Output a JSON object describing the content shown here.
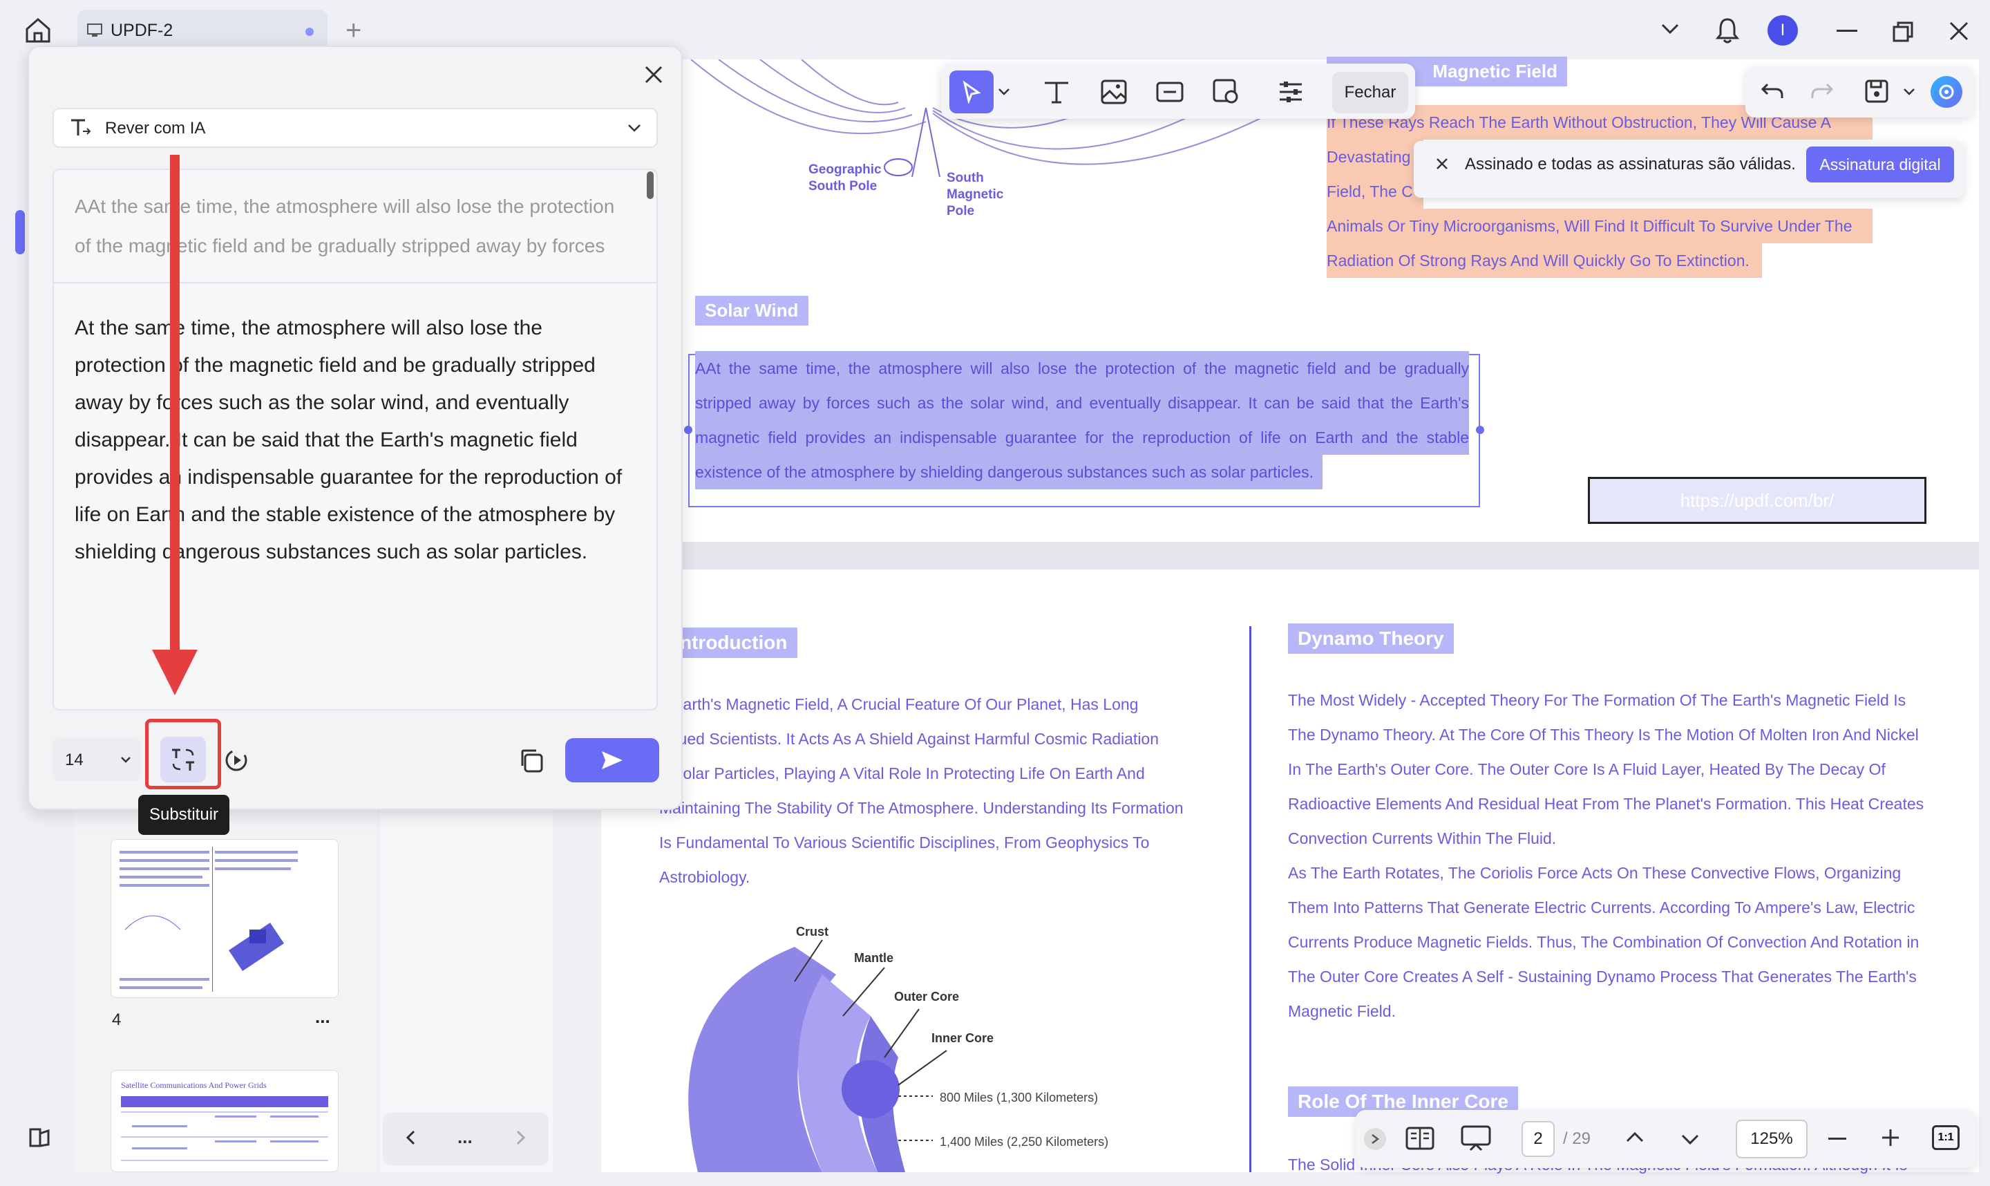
{
  "tab": {
    "title": "UPDF-2",
    "add": "+"
  },
  "top_toolbar": {
    "close_label": "Fechar"
  },
  "notice": {
    "text": "Assinado e todas as assinaturas são válidas.",
    "button": "Assinatura digital"
  },
  "page_top": {
    "heading_magnetic": "Magnetic Field",
    "text_lines": [
      "If These Rays Reach The Earth Without Obstruction, They Will Cause A",
      "Devastating",
      "Field, The C",
      "Animals Or Tiny Microorganisms, Will Find It Difficult To Survive Under The",
      "Radiation Of Strong Rays And Will Quickly Go To Extinction."
    ],
    "labels": {
      "geo": "Geographic",
      "geo2": "South Pole",
      "south": "South",
      "south2": "Magnetic",
      "south3": "Pole"
    },
    "solar_heading": "Solar Wind",
    "selected_lines": [
      "AAt the same time, the atmosphere will also lose the protection of the magnetic field and be gradually",
      "stripped away by forces such as the solar wind, and eventually disappear. It can be said that the Earth's",
      "magnetic field provides an indispensable guarantee for the reproduction of life on Earth and the stable",
      "existence of the atmosphere by shielding dangerous substances such as solar particles."
    ],
    "link_box": "https://updf.com/br/"
  },
  "page_bottom": {
    "intro_heading": "ntroduction",
    "intro_lines": [
      "e Earth's Magnetic Field, A Crucial Feature Of Our Planet, Has Long",
      "rigued Scientists. It Acts As A Shield Against Harmful Cosmic Radiation",
      "d Solar Particles, Playing A Vital Role In Protecting Life On Earth And",
      "Maintaining The Stability Of The Atmosphere. Understanding Its Formation",
      "Is Fundamental To Various Scientific Disciplines, From Geophysics To",
      "Astrobiology."
    ],
    "dynamo_heading": "Dynamo Theory",
    "dynamo_lines": [
      "The Most Widely - Accepted Theory For The Formation Of The Earth's Magnetic Field Is",
      "The Dynamo Theory. At The Core Of This Theory Is The Motion Of Molten Iron And Nickel",
      "In The Earth's Outer Core. The Outer Core Is A Fluid Layer, Heated By The Decay Of",
      "Radioactive Elements And Residual Heat From The Planet's Formation. This Heat Creates",
      "Convection Currents Within The Fluid.",
      "As The Earth Rotates, The Coriolis Force Acts On These Convective Flows, Organizing",
      "Them Into Patterns That Generate Electric Currents. According To Ampere's Law, Electric",
      "Currents Produce Magnetic Fields. Thus, The Combination Of Convection And Rotation in",
      "The Outer Core Creates A Self - Sustaining Dynamo Process That Generates The Earth's",
      "Magnetic Field."
    ],
    "inner_heading": "Role Of The Inner Core",
    "inner_text": "The Solid Inner Core Also Plays A Role In The Magnetic Field's Formation. Although It Is",
    "diagram": {
      "crust": "Crust",
      "mantle": "Mantle",
      "outer": "Outer Core",
      "inner": "Inner Core",
      "d1": "800 Miles (1,300 Kilometers)",
      "d2": "1,400 Miles (2,250 Kilometers)"
    }
  },
  "ai_panel": {
    "mode": "Rever com IA",
    "original": "AAt the same time, the atmosphere will also lose the protection of the magnetic field and be gradually stripped away by forces",
    "result": "At the same time, the atmosphere will also lose the protection of the magnetic field and be gradually stripped away by forces such as the solar wind, and eventually disappear. It can be said that the Earth's magnetic field provides an indispensable guarantee for the reproduction of life on Earth and the stable existence of the atmosphere by shielding dangerous substances such as solar particles.",
    "font_size": "14",
    "tooltip": "Substituir"
  },
  "thumbnails": {
    "page_num": "4",
    "more": "...",
    "next_title": "Satellite Communications And Power Grids"
  },
  "thumb_nav": {
    "more": "..."
  },
  "bottom_bar": {
    "page": "2",
    "total": "/ 29",
    "zoom": "125%"
  },
  "colors": {
    "accent": "#6b6cf6",
    "highlight": "#f9c9b2",
    "selection": "#b2b2f2",
    "arrow": "#e53e3e"
  }
}
